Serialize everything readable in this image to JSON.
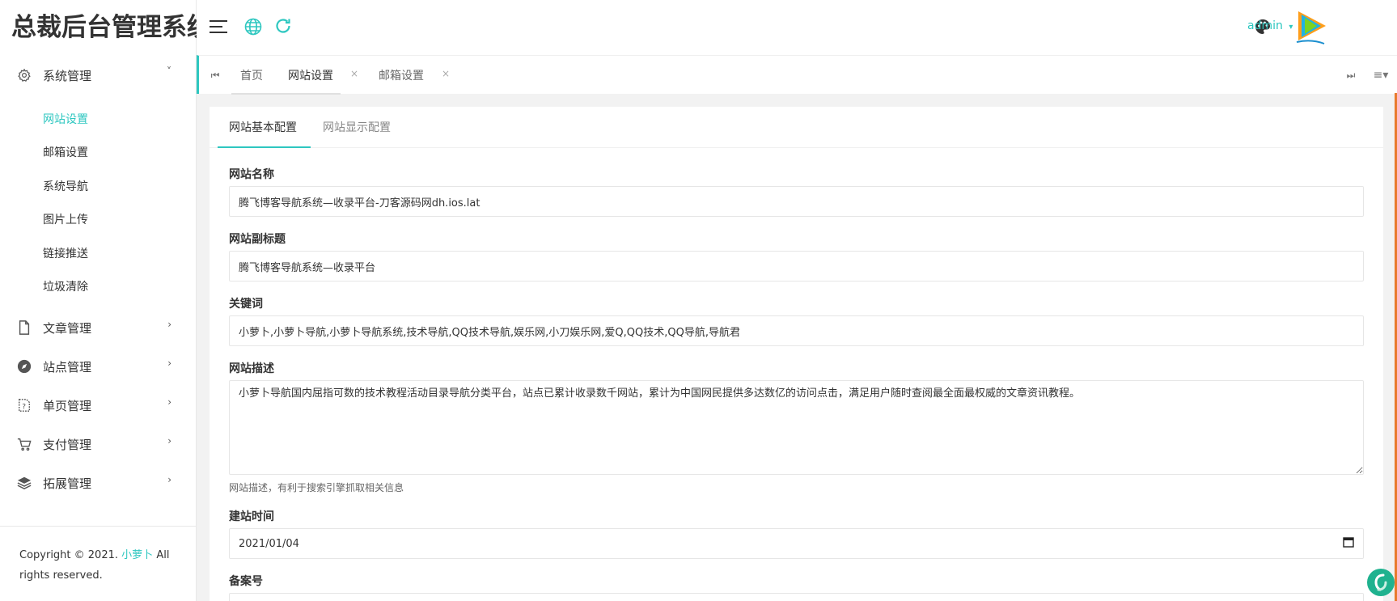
{
  "app": {
    "title": "总裁后台管理系统"
  },
  "sidebar": {
    "groups": [
      {
        "label": "系统管理",
        "icon": "gear-icon",
        "expanded": true,
        "items": [
          {
            "label": "网站设置",
            "active": true
          },
          {
            "label": "邮箱设置"
          },
          {
            "label": "系统导航"
          },
          {
            "label": "图片上传"
          },
          {
            "label": "链接推送"
          },
          {
            "label": "垃圾清除"
          }
        ]
      },
      {
        "label": "文章管理",
        "icon": "file-icon"
      },
      {
        "label": "站点管理",
        "icon": "compass-icon"
      },
      {
        "label": "单页管理",
        "icon": "help-page-icon"
      },
      {
        "label": "支付管理",
        "icon": "cart-icon"
      },
      {
        "label": "拓展管理",
        "icon": "layers-icon"
      }
    ],
    "copyright": {
      "prefix": "Copyright © 2021.",
      "brand": "小萝卜",
      "suffix": "All rights reserved."
    }
  },
  "header": {
    "user": "admin",
    "icons": [
      "menu-icon",
      "globe-icon",
      "refresh-icon",
      "palette-icon",
      "video-logo-icon"
    ],
    "accent": "#2ec7c0"
  },
  "tabbar": {
    "tabs": [
      {
        "label": "首页"
      },
      {
        "label": "网站设置",
        "active": true,
        "closable": true
      },
      {
        "label": "邮箱设置",
        "closable": true
      }
    ],
    "close_glyph": "×"
  },
  "content": {
    "tabs": [
      {
        "label": "网站基本配置",
        "active": true
      },
      {
        "label": "网站显示配置"
      }
    ],
    "fields": {
      "site_name": {
        "label": "网站名称",
        "value": "腾飞博客导航系统—收录平台-刀客源码网dh.ios.lat"
      },
      "subtitle": {
        "label": "网站副标题",
        "value": "腾飞博客导航系统—收录平台"
      },
      "keywords": {
        "label": "关键词",
        "value": "小萝卜,小萝卜导航,小萝卜导航系统,技术导航,QQ技术导航,娱乐网,小刀娱乐网,爱Q,QQ技术,QQ导航,导航君"
      },
      "description": {
        "label": "网站描述",
        "value": "小萝卜导航国内屈指可数的技术教程活动目录导航分类平台，站点已累计收录数千网站，累计为中国网民提供多达数亿的访问点击，满足用户随时查阅最全面最权威的文章资讯教程。",
        "help": "网站描述，有利于搜索引擎抓取相关信息"
      },
      "build_date": {
        "label": "建站时间",
        "value": "2021/01/04"
      },
      "icp": {
        "label": "备案号"
      }
    }
  }
}
